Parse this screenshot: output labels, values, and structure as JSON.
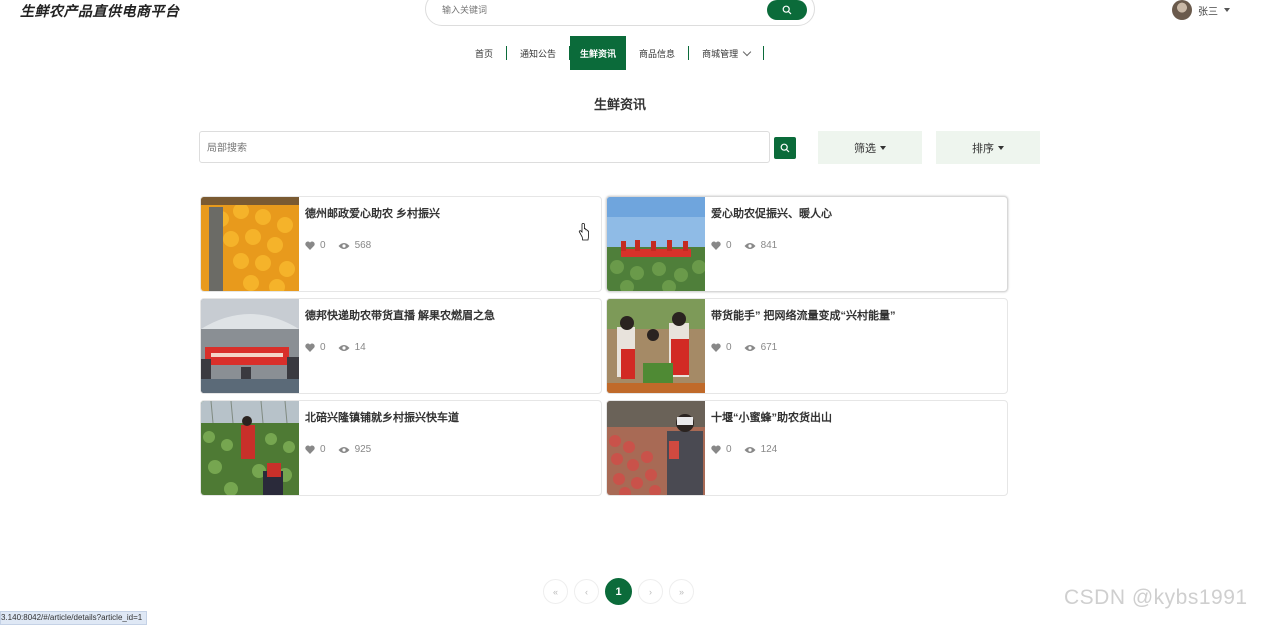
{
  "header": {
    "site_title": "生鲜农产品直供电商平台",
    "search_placeholder": "输入关键词",
    "user_name": "张三"
  },
  "nav": {
    "items": [
      {
        "label": "首页",
        "active": false
      },
      {
        "label": "通知公告",
        "active": false
      },
      {
        "label": "生鲜资讯",
        "active": true
      },
      {
        "label": "商品信息",
        "active": false
      },
      {
        "label": "商城管理",
        "active": false
      }
    ]
  },
  "page": {
    "title": "生鲜资讯",
    "local_search_placeholder": "局部搜索",
    "filter_label": "筛选",
    "sort_label": "排序"
  },
  "articles": [
    {
      "title": "德州邮政爱心助农 乡村振兴",
      "likes": "0",
      "views": "568"
    },
    {
      "title": "爱心助农促振兴、暖人心",
      "likes": "0",
      "views": "841"
    },
    {
      "title": "德邦快递助农带货直播 解果农燃眉之急",
      "likes": "0",
      "views": "14"
    },
    {
      "title": "带货能手” 把网络流量变成“兴村能量”",
      "likes": "0",
      "views": "671"
    },
    {
      "title": "北碚兴隆镇铺就乡村振兴快车道",
      "likes": "0",
      "views": "925"
    },
    {
      "title": "十堰“小蜜蜂”助农货出山",
      "likes": "0",
      "views": "124"
    }
  ],
  "pagination": {
    "first": "«",
    "prev": "‹",
    "current": "1",
    "next": "›",
    "last": "»"
  },
  "status_bar": {
    "url": "3.140:8042/#/article/details?article_id=1"
  },
  "watermark": "CSDN @kybs1991",
  "colors": {
    "accent": "#0b6b3a",
    "pill_bg": "#eef5ee"
  }
}
